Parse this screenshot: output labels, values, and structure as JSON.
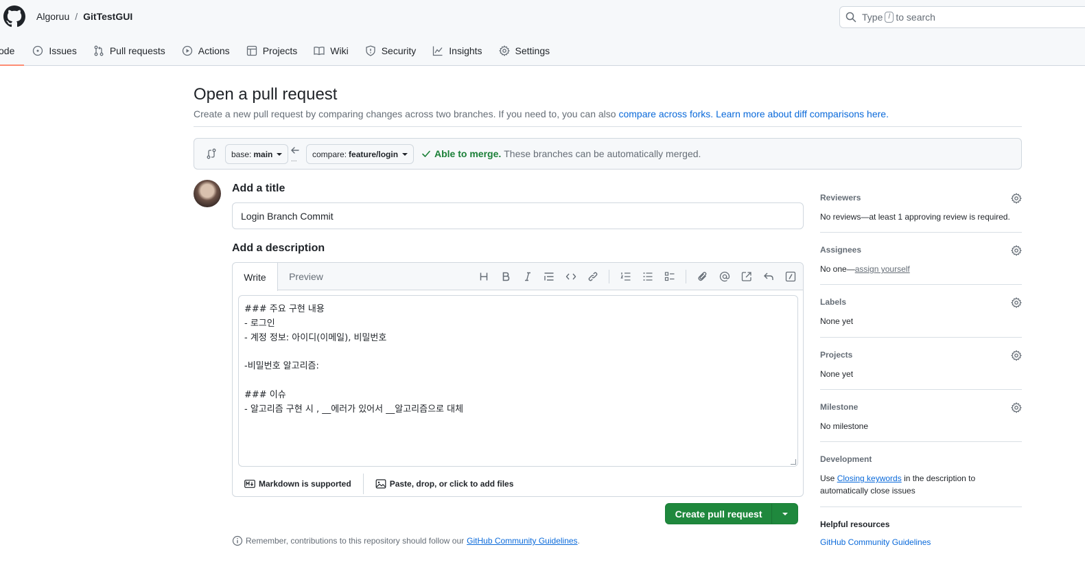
{
  "header": {
    "owner": "Algoruu",
    "separator": "/",
    "repo": "GitTestGUI",
    "search_prefix": "Type",
    "search_key": "/",
    "search_suffix": "to search"
  },
  "tabs": [
    {
      "label": "ode",
      "icon": "code-icon",
      "active": true
    },
    {
      "label": "Issues",
      "icon": "issue-icon"
    },
    {
      "label": "Pull requests",
      "icon": "pull-request-icon"
    },
    {
      "label": "Actions",
      "icon": "play-icon"
    },
    {
      "label": "Projects",
      "icon": "table-icon"
    },
    {
      "label": "Wiki",
      "icon": "book-icon"
    },
    {
      "label": "Security",
      "icon": "shield-icon"
    },
    {
      "label": "Insights",
      "icon": "graph-icon"
    },
    {
      "label": "Settings",
      "icon": "gear-icon"
    }
  ],
  "page": {
    "title": "Open a pull request",
    "subtitle": "Create a new pull request by comparing changes across two branches. If you need to, you can also",
    "link_forks": "compare across forks.",
    "link_learn": "Learn more about diff comparisons here."
  },
  "compare": {
    "base_prefix": "base:",
    "base_branch": "main",
    "compare_prefix": "compare:",
    "compare_branch": "feature/login",
    "ellipsis": "...",
    "status_ok": "Able to merge.",
    "status_text": "These branches can be automatically merged."
  },
  "form": {
    "title_label": "Add a title",
    "title_value": "Login Branch Commit",
    "desc_label": "Add a description",
    "tab_write": "Write",
    "tab_preview": "Preview",
    "body_lines": [
      "### 주요 구현 내용",
      "- 로그인",
      "- 계정 정보: 아이디(이메일), 비밀번호",
      "",
      "-비밀번호 알고리즘:",
      "",
      "### 이슈",
      "- 알고리즘 구현 시 , __에러가 있어서 __알고리즘으로 대체"
    ],
    "markdown_note": "Markdown is supported",
    "files_note": "Paste, drop, or click to add files",
    "submit_label": "Create pull request",
    "remember_text": "Remember, contributions to this repository should follow our",
    "remember_link": "GitHub Community Guidelines",
    "remember_end": "."
  },
  "sidebar": {
    "reviewers_title": "Reviewers",
    "reviewers_value": "No reviews—at least 1 approving review is required.",
    "assignees_title": "Assignees",
    "assignees_prefix": "No one—",
    "assignees_link": "assign yourself",
    "labels_title": "Labels",
    "labels_value": "None yet",
    "projects_title": "Projects",
    "projects_value": "None yet",
    "milestone_title": "Milestone",
    "milestone_value": "No milestone",
    "development_title": "Development",
    "dev_prefix": "Use",
    "dev_link": "Closing keywords",
    "dev_suffix": "in the description to automatically close issues",
    "help_title": "Helpful resources",
    "help_link": "GitHub Community Guidelines"
  },
  "colors": {
    "accent": "#0969da",
    "success": "#1f883d",
    "tab_underline": "#fd8c73"
  }
}
